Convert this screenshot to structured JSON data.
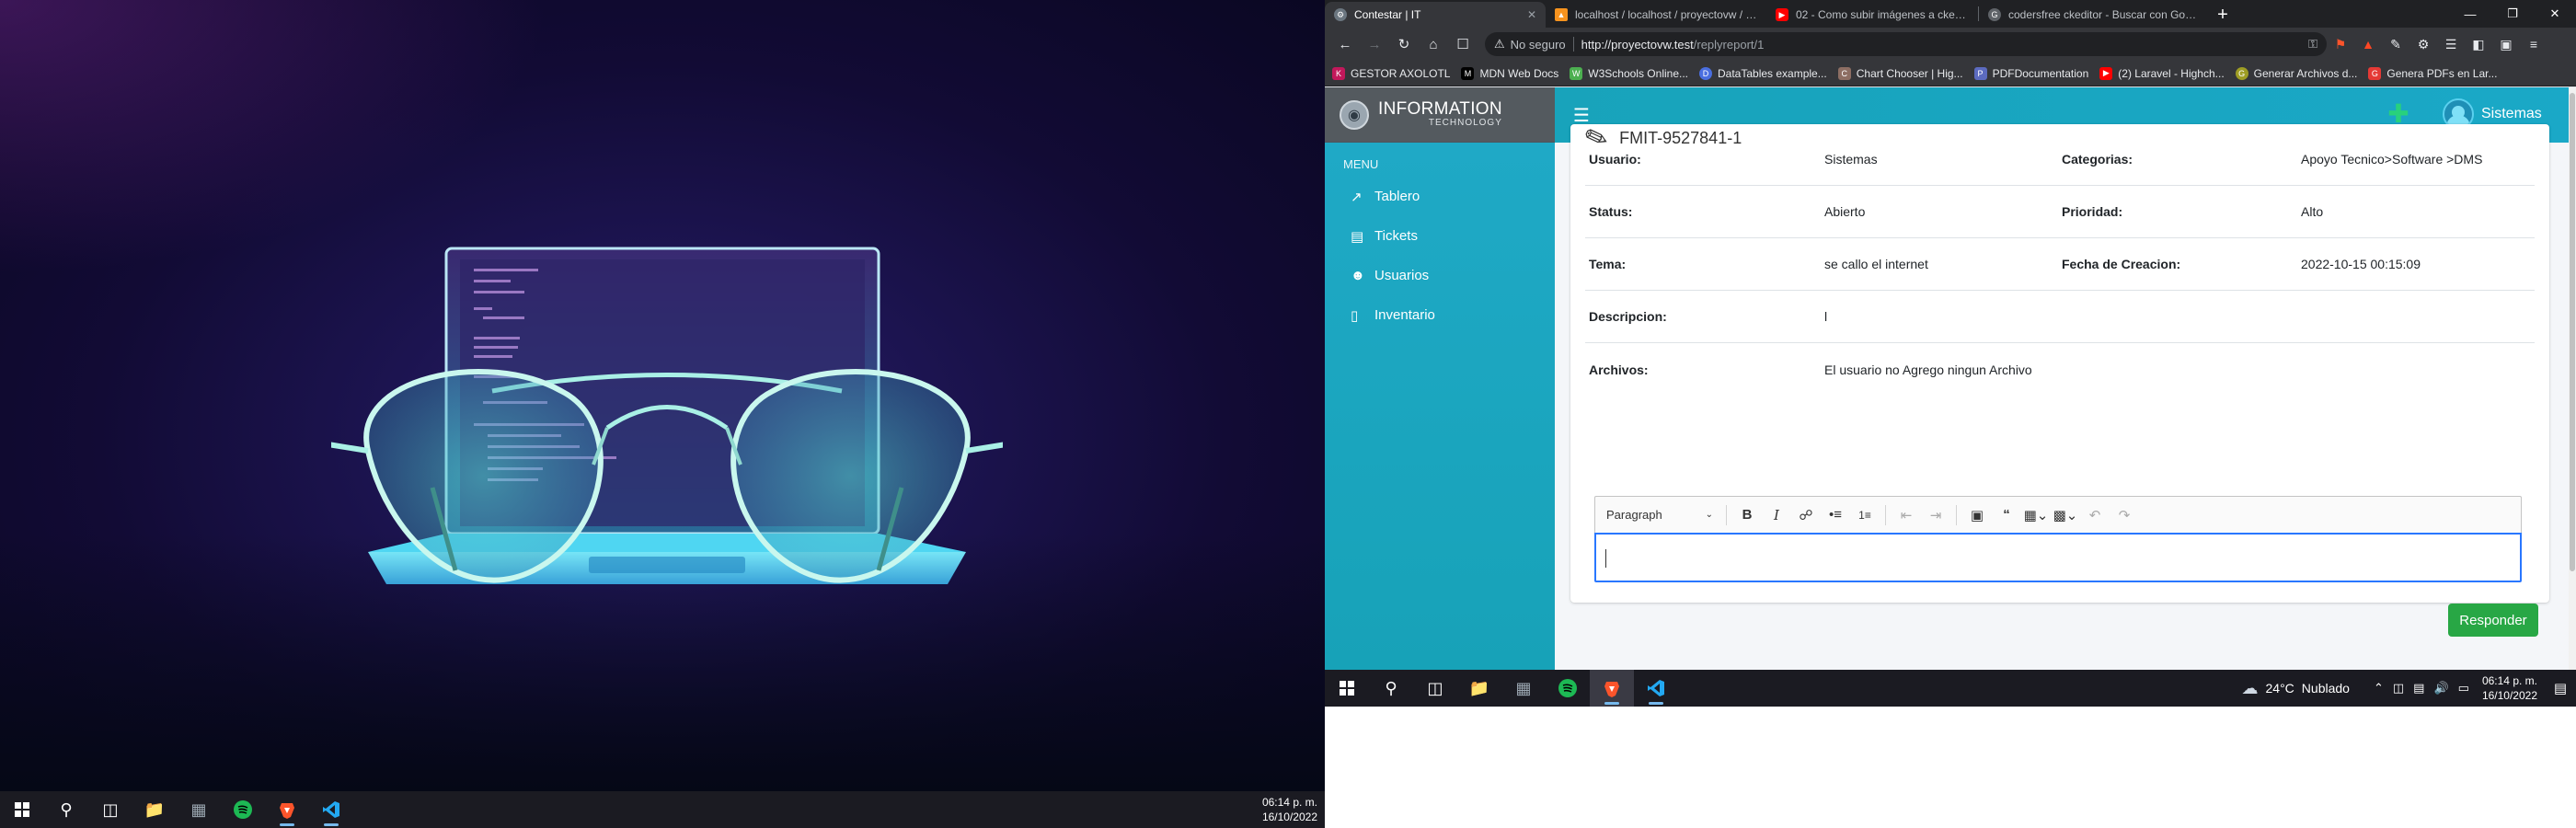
{
  "left_taskbar": {
    "time": "06:14 p. m.",
    "date": "16/10/2022"
  },
  "browser": {
    "tabs": [
      {
        "title": "Contestar | IT",
        "active": true
      },
      {
        "title": "localhost / localhost / proyectovw / replies | ...",
        "active": false
      },
      {
        "title": "02 - Como subir imágenes a ckeditor ...",
        "active": false
      },
      {
        "title": "codersfree ckeditor - Buscar con Google",
        "active": false
      }
    ],
    "address": {
      "security": "No seguro",
      "host": "http://proyectovw.test",
      "path": "/replyreport/1"
    },
    "bookmarks": [
      "GESTOR AXOLOTL",
      "MDN Web Docs",
      "W3Schools Online...",
      "DataTables example...",
      "Chart Chooser | Hig...",
      "PDFDocumentation",
      "(2) Laravel - Highch...",
      "Generar Archivos d...",
      "Genera PDFs en Lar..."
    ]
  },
  "app": {
    "brand_title": "INFORMATION",
    "brand_subtitle": "TECHNOLOGY",
    "user_name": "Sistemas",
    "menu_label": "MENU",
    "nav": [
      {
        "label": "Tablero",
        "icon": "chart-line-icon"
      },
      {
        "label": "Tickets",
        "icon": "ticket-icon"
      },
      {
        "label": "Usuarios",
        "icon": "users-icon"
      },
      {
        "label": "Inventario",
        "icon": "clipboard-icon"
      }
    ],
    "ticket": {
      "id": "FMIT-9527841-1",
      "rows": [
        {
          "label": "Usuario:",
          "value": "Sistemas",
          "label2": "Categorias:",
          "value2": "Apoyo Tecnico>Software >DMS"
        },
        {
          "label": "Status:",
          "value": "Abierto",
          "label2": "Prioridad:",
          "value2": "Alto"
        },
        {
          "label": "Tema:",
          "value": "se callo el internet",
          "label2": "Fecha de Creacion:",
          "value2": "2022-10-15 00:15:09"
        },
        {
          "label": "Descripcion:",
          "value": "l",
          "label2": "",
          "value2": ""
        },
        {
          "label": "Archivos:",
          "value": "El usuario no Agrego ningun Archivo",
          "label2": "",
          "value2": ""
        }
      ]
    },
    "editor": {
      "paragraph_label": "Paragraph"
    },
    "reply_button": "Responder"
  },
  "right_taskbar": {
    "weather_temp": "24°C",
    "weather_desc": "Nublado",
    "time": "06:14 p. m.",
    "date": "16/10/2022"
  }
}
